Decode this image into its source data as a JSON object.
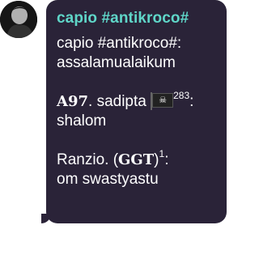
{
  "message": {
    "sender": "capio #antikroco#",
    "lines": {
      "line1": "capio #antikroco#:",
      "line2": "assalamualaikum",
      "p2_tag": "A97",
      "p2_rest": ". sadipta",
      "p2_sup": "283",
      "p2_colon": ":",
      "p2_line2": "shalom",
      "p3_pre": "Ranzio. (",
      "p3_tag": "GGT",
      "p3_close": ")",
      "p3_sup": "1",
      "p3_colon": ":",
      "p3_line2": "om swastyastu"
    },
    "flag_icon": "pirate-flag-icon"
  },
  "colors": {
    "bubble": "#2a2338",
    "sender": "#5fd6c8",
    "text": "#ffffff",
    "background": "#ffffff"
  }
}
